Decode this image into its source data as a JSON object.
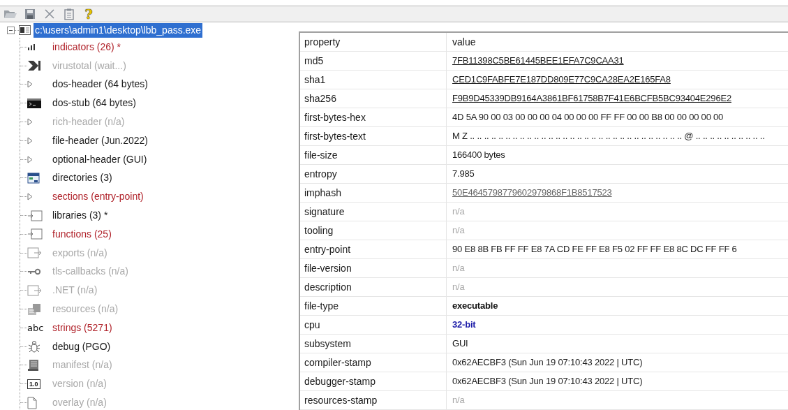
{
  "toolbar": {
    "buttons": [
      {
        "kind": "open"
      },
      {
        "kind": "save"
      },
      {
        "kind": "cut"
      },
      {
        "kind": "clipboard"
      },
      {
        "kind": "help",
        "glyph": "?"
      }
    ]
  },
  "tree": {
    "root": {
      "label": "c:\\users\\admin1\\desktop\\lbb_pass.exe",
      "selected": true,
      "expanded": true
    },
    "children": [
      {
        "label": "indicators (26) *",
        "kind": "chart",
        "flagged": true,
        "disabled": false,
        "selected": false
      },
      {
        "label": "virustotal (wait...)",
        "kind": "virustotal",
        "flagged": false,
        "disabled": true,
        "selected": false
      },
      {
        "label": "dos-header (64 bytes)",
        "kind": "arrow",
        "flagged": false,
        "disabled": false,
        "selected": false
      },
      {
        "label": "dos-stub (64 bytes)",
        "kind": "console",
        "flagged": false,
        "disabled": false,
        "selected": false
      },
      {
        "label": "rich-header (n/a)",
        "kind": "arrow",
        "flagged": false,
        "disabled": true,
        "selected": false
      },
      {
        "label": "file-header (Jun.2022)",
        "kind": "arrow",
        "flagged": false,
        "disabled": false,
        "selected": false
      },
      {
        "label": "optional-header (GUI)",
        "kind": "arrow",
        "flagged": false,
        "disabled": false,
        "selected": false
      },
      {
        "label": "directories (3)",
        "kind": "grid",
        "flagged": false,
        "disabled": false,
        "selected": false
      },
      {
        "label": "sections (entry-point)",
        "kind": "arrow",
        "flagged": true,
        "disabled": false,
        "selected": false
      },
      {
        "label": "libraries (3) *",
        "kind": "library",
        "flagged": false,
        "disabled": false,
        "selected": false
      },
      {
        "label": "functions (25)",
        "kind": "library",
        "flagged": true,
        "disabled": false,
        "selected": false
      },
      {
        "label": "exports (n/a)",
        "kind": "export",
        "flagged": false,
        "disabled": true,
        "selected": false
      },
      {
        "label": "tls-callbacks (n/a)",
        "kind": "key",
        "flagged": false,
        "disabled": true,
        "selected": false
      },
      {
        "label": ".NET (n/a)",
        "kind": "export",
        "flagged": false,
        "disabled": true,
        "selected": false
      },
      {
        "label": "resources (n/a)",
        "kind": "resource",
        "flagged": false,
        "disabled": true,
        "selected": false
      },
      {
        "label": "strings (5271)",
        "kind": "text",
        "icon_text": "abc",
        "flagged": true,
        "disabled": false,
        "selected": false
      },
      {
        "label": "debug (PGO)",
        "kind": "bug",
        "flagged": false,
        "disabled": false,
        "selected": false
      },
      {
        "label": "manifest (n/a)",
        "kind": "manifest",
        "flagged": false,
        "disabled": true,
        "selected": false
      },
      {
        "label": "version (n/a)",
        "kind": "version",
        "icon_text": "1.0",
        "flagged": false,
        "disabled": true,
        "selected": false
      },
      {
        "label": "overlay (n/a)",
        "kind": "page",
        "flagged": false,
        "disabled": true,
        "selected": false
      }
    ]
  },
  "table": {
    "columns": [
      "property",
      "value"
    ],
    "rows": [
      {
        "property": "md5",
        "value": "7FB11398C5BE61445BEE1EFA7C9CAA31",
        "kind": "link"
      },
      {
        "property": "sha1",
        "value": "CED1C9FABFE7E187DD809E77C9CA28EA2E165FA8",
        "kind": "link"
      },
      {
        "property": "sha256",
        "value": "F9B9D45339DB9164A3861BF61758B7F41E6BCFB5BC93404E296E2",
        "kind": "link"
      },
      {
        "property": "first-bytes-hex",
        "value": "4D 5A 90 00 03 00 00 00 04 00 00 00 FF FF 00 00 B8 00 00 00 00 00",
        "kind": "plain"
      },
      {
        "property": "first-bytes-text",
        "value": "M Z .. .. .. .. .. .. .. .. .. .. .. .. .. .. .. .. .. .. .. .. .. .. .. .. .. .. .. .. .. .. @ .. .. .. .. .. .. .. .. .. ..",
        "kind": "plain"
      },
      {
        "property": "file-size",
        "value": "166400 bytes",
        "kind": "plain"
      },
      {
        "property": "entropy",
        "value": "7.985",
        "kind": "plain"
      },
      {
        "property": "imphash",
        "value": "50E4645798779602979868F1B8517523",
        "kind": "link_muted"
      },
      {
        "property": "signature",
        "value": "n/a",
        "kind": "muted"
      },
      {
        "property": "tooling",
        "value": "n/a",
        "kind": "muted"
      },
      {
        "property": "entry-point",
        "value": "90 E8 8B FB FF FF E8 7A CD FE FF E8 F5 02 FF FF E8 8C DC FF FF 6",
        "kind": "plain"
      },
      {
        "property": "file-version",
        "value": "n/a",
        "kind": "muted"
      },
      {
        "property": "description",
        "value": "n/a",
        "kind": "muted"
      },
      {
        "property": "file-type",
        "value": "executable",
        "kind": "bold"
      },
      {
        "property": "cpu",
        "value": "32-bit",
        "kind": "accent"
      },
      {
        "property": "subsystem",
        "value": "GUI",
        "kind": "plain"
      },
      {
        "property": "compiler-stamp",
        "value": "0x62AECBF3 (Sun Jun 19 07:10:43 2022 | UTC)",
        "kind": "plain"
      },
      {
        "property": "debugger-stamp",
        "value": "0x62AECBF3 (Sun Jun 19 07:10:43 2022 | UTC)",
        "kind": "plain"
      },
      {
        "property": "resources-stamp",
        "value": "n/a",
        "kind": "muted"
      }
    ]
  }
}
